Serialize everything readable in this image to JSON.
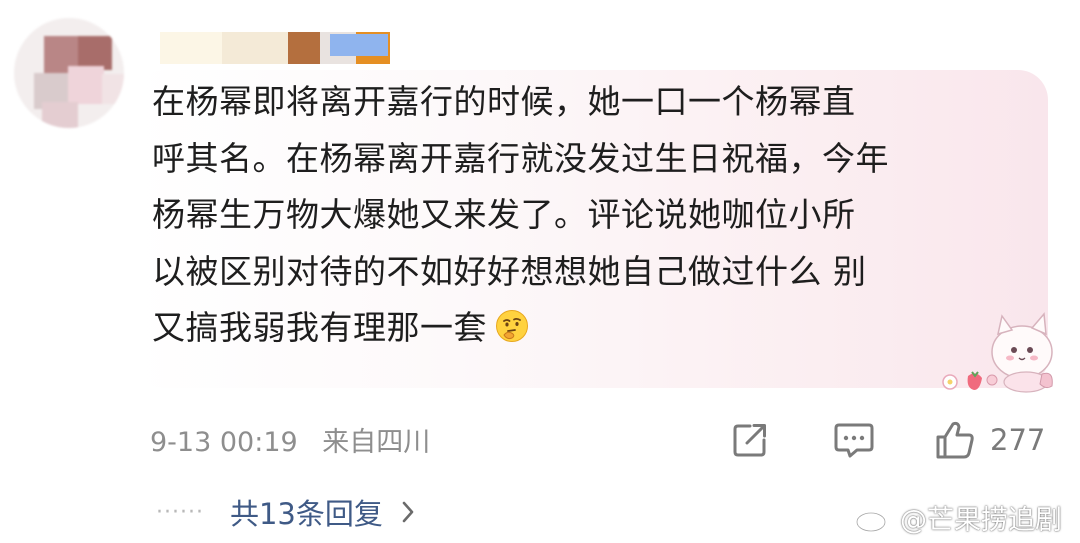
{
  "comment": {
    "text_lines": [
      "在杨幂即将离开嘉行的时候，她一口一个杨幂直",
      "呼其名。在杨幂离开嘉行就没发过生日祝福，今年",
      "杨幂生万物大爆她又来发了。评论说她咖位小所",
      "以被区别对待的不如好好想想她自己做过什么  别",
      "又搞我弱我有理那一套"
    ],
    "emoji": "thinking-face-emoji"
  },
  "meta": {
    "date_time": "9-13 00:19",
    "location": "来自四川"
  },
  "actions": {
    "like_count": "277"
  },
  "replies": {
    "dots": "······",
    "label": "共13条回复",
    "chevron": "›"
  },
  "watermark": {
    "text": "@芒果捞追剧"
  },
  "colors": {
    "bubble_tint": "#f9e6ec",
    "link_blue": "#3f5a86",
    "meta_gray": "#8e8e8e"
  }
}
